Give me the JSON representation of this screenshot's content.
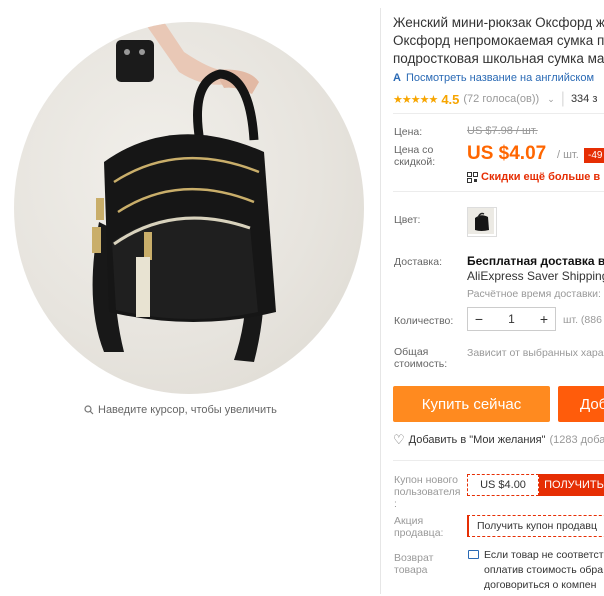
{
  "product": {
    "title_lines": [
      "Женский мини-рюкзак Оксфорд ж",
      "Оксфорд непромокаемая сумка пе",
      "подростковая школьная сумка ма"
    ],
    "translate_link": "Посмотреть название на английском",
    "rating_value": "4.5",
    "rating_stars": "★★★★★",
    "votes": "(72 голоса(ов))",
    "sold": "334 з"
  },
  "gallery": {
    "zoom_hint": "Наведите курсор, чтобы увеличить"
  },
  "pricing": {
    "price_label": "Цена:",
    "old_price": "US $7.98 / шт.",
    "discount_label_line1": "Цена со",
    "discount_label_line2": "скидкой:",
    "current_price": "US $4.07",
    "per_unit": "/ шт.",
    "discount_badge": "-49",
    "coupon_note": "Скидки ещё больше в пр"
  },
  "options": {
    "color_label": "Цвет:",
    "delivery_label": "Доставка:",
    "delivery_line1": "Бесплатная доставка в Ru",
    "delivery_line2": "AliExpress Saver Shipping",
    "delivery_estimate": "Расчётное время доставки:",
    "quantity_label": "Количество:",
    "quantity_value": "1",
    "minus": "−",
    "plus": "+",
    "stock": "шт. (886",
    "total_label_line1": "Общая",
    "total_label_line2": "стоимость:",
    "total_note": "Зависит от выбранных хара"
  },
  "actions": {
    "buy_now": "Купить сейчас",
    "add_to_cart": "Доб",
    "wishlist": "Добавить в \"Мои желания\"",
    "wishlist_count": "(1283 доба"
  },
  "promotions": {
    "new_user_label_line1": "Купон нового",
    "new_user_label_line2": "пользователя",
    "new_user_label_line3": ":",
    "new_user_coupon": "US $4.00",
    "get_coupon": "ПОЛУЧИТЬ",
    "seller_label_line1": "Акция",
    "seller_label_line2": "продавца:",
    "seller_coupon": "Получить купон продавц",
    "return_label_line1": "Возврат",
    "return_label_line2": "товара",
    "return_line1": "Если товар не соответст",
    "return_line2": "оплатив стоимость обра",
    "return_line3": "договориться о компен"
  },
  "colors": {
    "accent_orange": "#ff8a1f",
    "cart_orange": "#ff5c0b",
    "price_orange": "#ff6600",
    "alert_red": "#e62e04",
    "link_blue": "#2a6ab5",
    "star_yellow": "#f7a500"
  }
}
